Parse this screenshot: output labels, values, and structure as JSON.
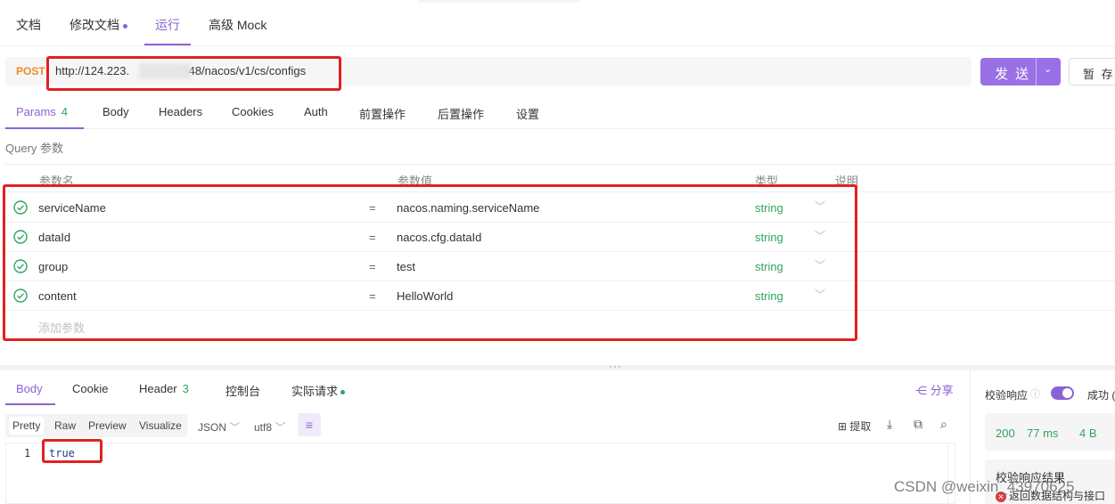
{
  "top_tabs": [
    {
      "label": "文档"
    },
    {
      "label": "修改文档"
    },
    {
      "label": "运行"
    },
    {
      "label": "高级 Mock"
    }
  ],
  "request": {
    "method": "POST",
    "url_prefix": "http://124.223.",
    "url_suffix": "8848/nacos/v1/cs/configs",
    "send_label": "发 送",
    "save_label": "暂 存"
  },
  "request_tabs": [
    {
      "label": "Params",
      "count": "4"
    },
    {
      "label": "Body"
    },
    {
      "label": "Headers"
    },
    {
      "label": "Cookies"
    },
    {
      "label": "Auth"
    },
    {
      "label": "前置操作"
    },
    {
      "label": "后置操作"
    },
    {
      "label": "设置"
    }
  ],
  "query_title": "Query 参数",
  "params_table": {
    "headers": {
      "name": "参数名",
      "value": "参数值",
      "type": "类型",
      "desc": "说明"
    },
    "rows": [
      {
        "name": "serviceName",
        "eq": "=",
        "value": "nacos.naming.serviceName",
        "type": "string"
      },
      {
        "name": "dataId",
        "eq": "=",
        "value": "nacos.cfg.dataId",
        "type": "string"
      },
      {
        "name": "group",
        "eq": "=",
        "value": "test",
        "type": "string"
      },
      {
        "name": "content",
        "eq": "=",
        "value": "HelloWorld",
        "type": "string"
      }
    ],
    "add_placeholder": "添加参数"
  },
  "response_tabs": [
    {
      "label": "Body"
    },
    {
      "label": "Cookie"
    },
    {
      "label": "Header",
      "count": "3"
    },
    {
      "label": "控制台"
    },
    {
      "label": "实际请求"
    }
  ],
  "share_label": "分享",
  "format_buttons": [
    "Pretty",
    "Raw",
    "Preview",
    "Visualize"
  ],
  "format_select": "JSON",
  "encoding_select": "utf8",
  "extract_label": "提取",
  "editor": {
    "line": "1",
    "code": "true"
  },
  "right_panel": {
    "verify_label": "校验响应",
    "success_label": "成功 (",
    "status": "200",
    "time": "77 ms",
    "size": "4 B",
    "result_title": "校验响应结果",
    "result_error": "返回数据结构与接口"
  },
  "watermark": "CSDN @weixin_43970625",
  "colors": {
    "accent": "#8a63d2",
    "highlight": "#e32020",
    "type_green": "#2fa55f",
    "method_orange": "#f08a24"
  }
}
